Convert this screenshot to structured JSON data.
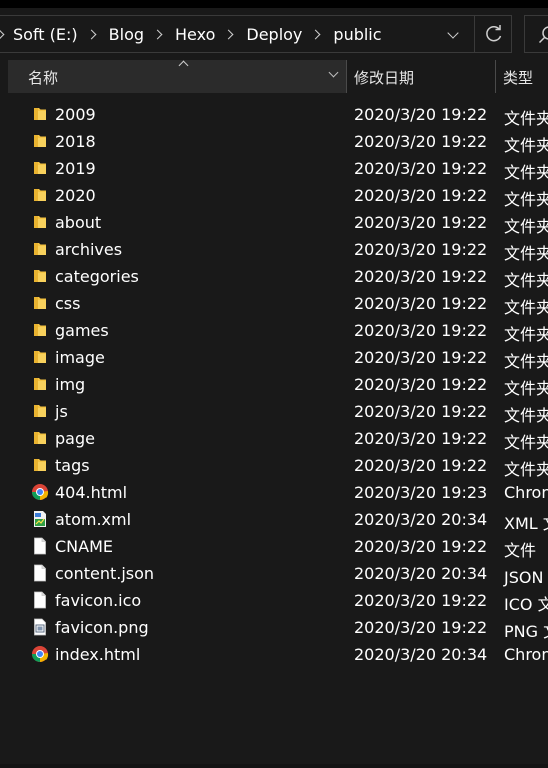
{
  "breadcrumb": {
    "items": [
      "Soft (E:)",
      "Blog",
      "Hexo",
      "Deploy",
      "public"
    ]
  },
  "columns": {
    "name": "名称",
    "date": "修改日期",
    "type": "类型"
  },
  "files": [
    {
      "name": "2009",
      "date": "2020/3/20 19:22",
      "type": "文件夹",
      "icon": "folder-icon"
    },
    {
      "name": "2018",
      "date": "2020/3/20 19:22",
      "type": "文件夹",
      "icon": "folder-icon"
    },
    {
      "name": "2019",
      "date": "2020/3/20 19:22",
      "type": "文件夹",
      "icon": "folder-icon"
    },
    {
      "name": "2020",
      "date": "2020/3/20 19:22",
      "type": "文件夹",
      "icon": "folder-icon"
    },
    {
      "name": "about",
      "date": "2020/3/20 19:22",
      "type": "文件夹",
      "icon": "folder-icon"
    },
    {
      "name": "archives",
      "date": "2020/3/20 19:22",
      "type": "文件夹",
      "icon": "folder-icon"
    },
    {
      "name": "categories",
      "date": "2020/3/20 19:22",
      "type": "文件夹",
      "icon": "folder-icon"
    },
    {
      "name": "css",
      "date": "2020/3/20 19:22",
      "type": "文件夹",
      "icon": "folder-icon"
    },
    {
      "name": "games",
      "date": "2020/3/20 19:22",
      "type": "文件夹",
      "icon": "folder-icon"
    },
    {
      "name": "image",
      "date": "2020/3/20 19:22",
      "type": "文件夹",
      "icon": "folder-icon"
    },
    {
      "name": "img",
      "date": "2020/3/20 19:22",
      "type": "文件夹",
      "icon": "folder-icon"
    },
    {
      "name": "js",
      "date": "2020/3/20 19:22",
      "type": "文件夹",
      "icon": "folder-icon"
    },
    {
      "name": "page",
      "date": "2020/3/20 19:22",
      "type": "文件夹",
      "icon": "folder-icon"
    },
    {
      "name": "tags",
      "date": "2020/3/20 19:22",
      "type": "文件夹",
      "icon": "folder-icon"
    },
    {
      "name": "404.html",
      "date": "2020/3/20 19:23",
      "type": "Chrom",
      "icon": "chrome-icon"
    },
    {
      "name": "atom.xml",
      "date": "2020/3/20 20:34",
      "type": "XML 文",
      "icon": "xml-file-icon"
    },
    {
      "name": "CNAME",
      "date": "2020/3/20 19:22",
      "type": "文件",
      "icon": "blank-file-icon"
    },
    {
      "name": "content.json",
      "date": "2020/3/20 20:34",
      "type": "JSON 文",
      "icon": "blank-file-icon"
    },
    {
      "name": "favicon.ico",
      "date": "2020/3/20 19:22",
      "type": "ICO 文",
      "icon": "blank-file-icon"
    },
    {
      "name": "favicon.png",
      "date": "2020/3/20 19:22",
      "type": "PNG 文",
      "icon": "image-file-icon"
    },
    {
      "name": "index.html",
      "date": "2020/3/20 20:34",
      "type": "Chrom",
      "icon": "chrome-icon"
    }
  ],
  "colors": {
    "background": "#191919",
    "header": "#2b2b2b",
    "folder": "#f5c442",
    "text": "#ffffff"
  }
}
